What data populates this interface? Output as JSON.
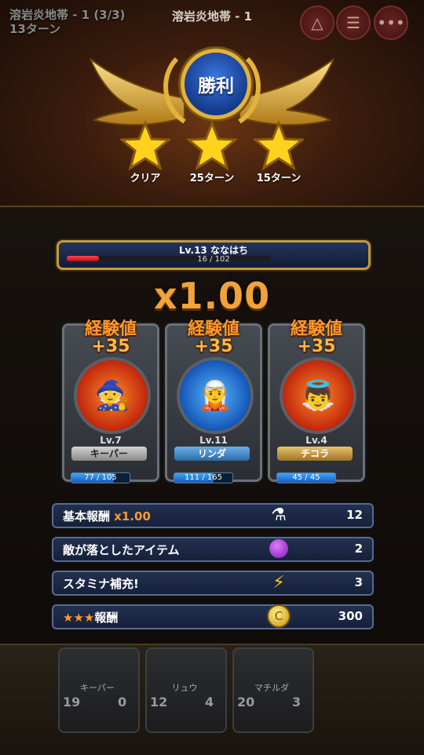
{
  "header": {
    "stage_title": "溶岩炎地帯 - 1 (3/3)",
    "turns": "13ターン",
    "center_title": "溶岩炎地帯 - 1"
  },
  "victory": {
    "label": "勝利",
    "stars": [
      {
        "label": "クリア"
      },
      {
        "label": "25ターン"
      },
      {
        "label": "15ターン"
      }
    ]
  },
  "player": {
    "name": "Lv.13 ななはち",
    "xp_text": "16 / 102",
    "xp_fraction": 0.157
  },
  "multiplier": "x1.00",
  "heroes": [
    {
      "exp_label": "経験値",
      "exp_value": "+35",
      "level": "Lv.7",
      "name": "キーパー",
      "hp_text": "77 / 105",
      "hp_fraction": 0.733,
      "icon": "red-hat-hero"
    },
    {
      "exp_label": "経験値",
      "exp_value": "+35",
      "level": "Lv.11",
      "name": "リンダ",
      "hp_text": "111 / 165",
      "hp_fraction": 0.673,
      "icon": "witch-hero"
    },
    {
      "exp_label": "経験値",
      "exp_value": "+35",
      "level": "Lv.4",
      "name": "チコラ",
      "hp_text": "45 / 45",
      "hp_fraction": 1.0,
      "icon": "angel-hero"
    }
  ],
  "rewards": [
    {
      "label": "基本報酬",
      "accent": "x1.00",
      "value": "12",
      "icon": "potion-icon"
    },
    {
      "label": "敵が落としたアイテム",
      "value": "2",
      "icon": "purple-orb-icon"
    },
    {
      "label": "スタミナ補充!",
      "value": "3",
      "icon": "lightning-icon"
    },
    {
      "label": "報酬",
      "stars": "★★★",
      "value": "300",
      "icon": "gold-coin-icon"
    }
  ],
  "background_team": [
    {
      "name": "キーパー",
      "left": "19",
      "right": "0"
    },
    {
      "name": "リュウ",
      "left": "12",
      "right": "4"
    },
    {
      "name": "マチルダ",
      "left": "20",
      "right": "3"
    }
  ],
  "colors": {
    "accent": "#ff9a2a",
    "gold": "#e3b33a",
    "xp_red": "#e02222",
    "hp_blue": "#2a86e0"
  }
}
